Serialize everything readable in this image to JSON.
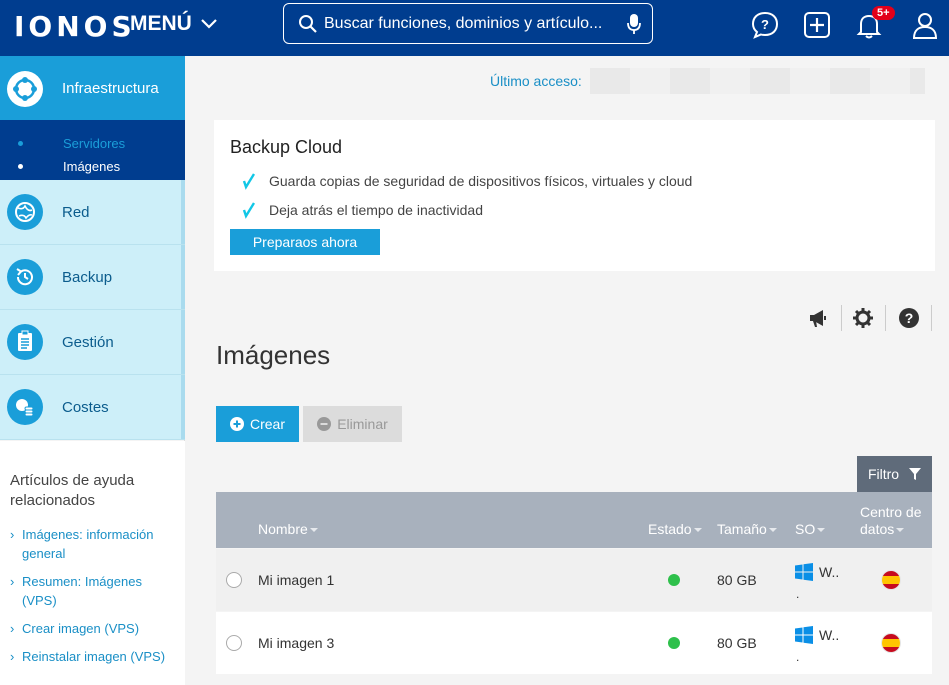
{
  "header": {
    "logo": "IONOS",
    "menu_label": "MENÚ",
    "search_placeholder": "Buscar funciones, dominios y artículo...",
    "notification_count": "5+"
  },
  "sidebar": {
    "items": [
      {
        "label": "Infraestructura",
        "icon": "network-hub-icon",
        "active": true
      },
      {
        "label": "Red",
        "icon": "globe-icon"
      },
      {
        "label": "Backup",
        "icon": "history-clock-icon"
      },
      {
        "label": "Gestión",
        "icon": "clipboard-icon"
      },
      {
        "label": "Costes",
        "icon": "coins-icon"
      }
    ],
    "sub_items": [
      {
        "label": "Servidores",
        "active": false
      },
      {
        "label": "Imágenes",
        "active": true
      }
    ],
    "help": {
      "title": "Artículos de ayuda relacionados",
      "links": [
        "Imágenes: información general",
        "Resumen: Imágenes (VPS)",
        "Crear imagen (VPS)",
        "Reinstalar imagen (VPS)"
      ]
    }
  },
  "main": {
    "last_access_label": "Último acceso:",
    "promo": {
      "title": "Backup Cloud",
      "features": [
        "Guarda copias de seguridad de dispositivos físicos, virtuales y cloud",
        "Deja atrás el tiempo de inactividad"
      ],
      "button": "Preparaos ahora"
    },
    "page_title": "Imágenes",
    "create_label": "Crear",
    "delete_label": "Eliminar",
    "filter_label": "Filtro",
    "table": {
      "columns": {
        "name": "Nombre",
        "status": "Estado",
        "size": "Tamaño",
        "os": "SO",
        "datacenter_1": "Centro de",
        "datacenter_2": "datos"
      },
      "rows": [
        {
          "name": "Mi imagen 1",
          "status": "active",
          "size": "80 GB",
          "os": "W..",
          "os_extra": ".",
          "datacenter": "es-flag"
        },
        {
          "name": "Mi imagen 3",
          "status": "active",
          "size": "80 GB",
          "os": "W..",
          "os_extra": ".",
          "datacenter": "es-flag"
        }
      ]
    }
  },
  "colors": {
    "brand_dark": "#003d8f",
    "accent": "#1a9ed9",
    "status_ok": "#2ec04b"
  }
}
